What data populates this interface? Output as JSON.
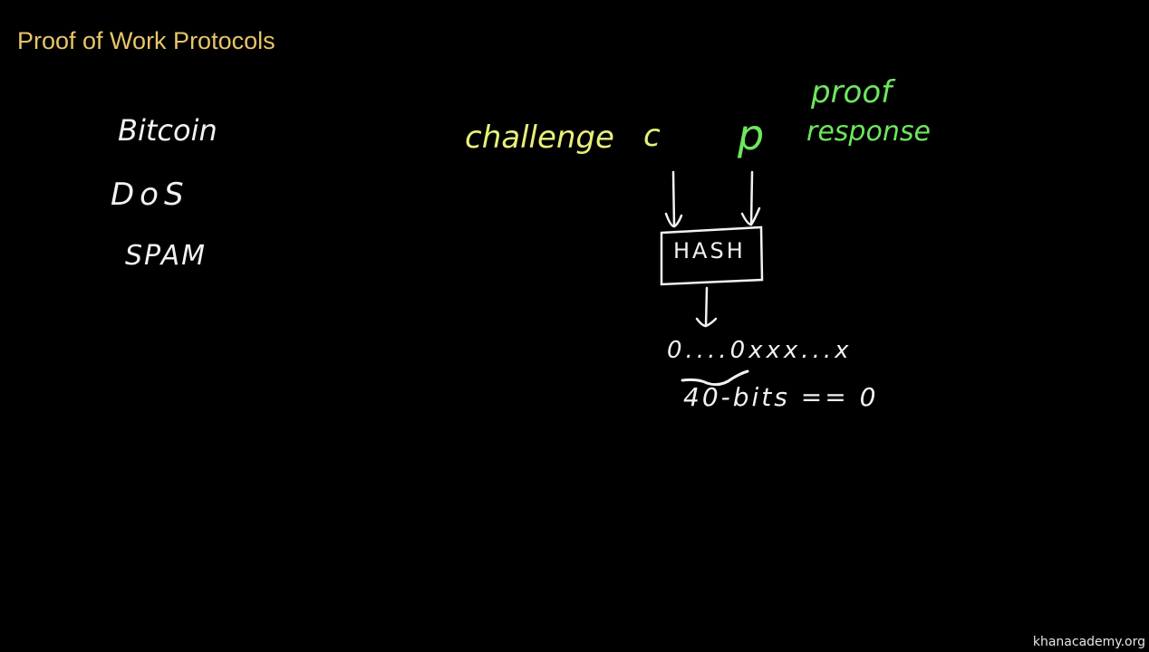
{
  "title": "Proof of Work Protocols",
  "left_list": [
    "Bitcoin",
    "DoS",
    "SPAM"
  ],
  "diagram": {
    "challenge_label": "challenge",
    "challenge_var": "c",
    "proof_var": "p",
    "proof_label": "proof",
    "response_label": "response",
    "box_label": "HASH",
    "output": "0....0xxx...x",
    "annotation": "40-bits == 0"
  },
  "colors": {
    "title": "#e8c56a",
    "chalk_white": "#f2f2f2",
    "chalk_yellow": "#e8ef7a",
    "chalk_green": "#6ee65e"
  },
  "watermark": "khanacademy.org"
}
